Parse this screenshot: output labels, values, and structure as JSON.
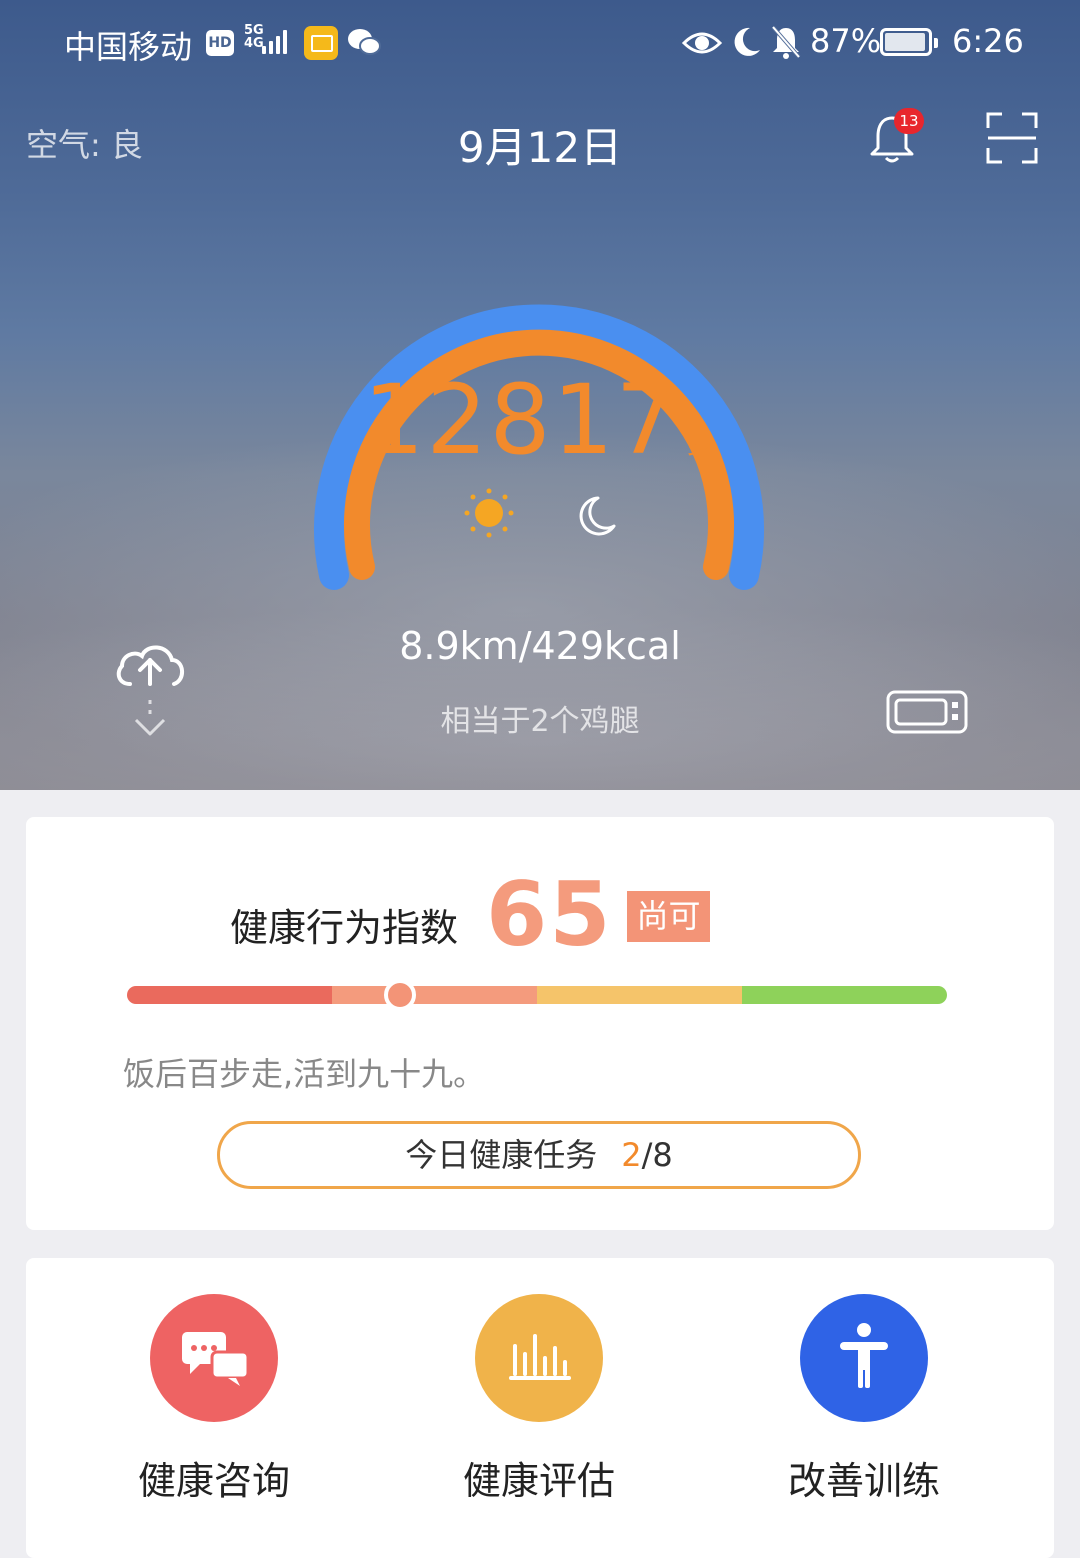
{
  "status_bar": {
    "carrier": "中国移动",
    "hd": "HD",
    "network_top": "5G",
    "network_bottom": "4G",
    "battery_percent": "87%",
    "time": "6:26"
  },
  "header": {
    "air_quality": "空气: 良",
    "date": "9月12日",
    "notification_count": "13"
  },
  "steps": {
    "count": "12817",
    "unit": "步",
    "distance_calories": "8.9km/429kcal",
    "equivalent": "相当于2个鸡腿",
    "gauge_fill_ratio": 0.98
  },
  "colors": {
    "gauge_blue": "#4a8ff0",
    "gauge_orange": "#f28a2c",
    "scale": [
      "#ea6a5d",
      "#f49b7d",
      "#f49b7d",
      "#f5c46a",
      "#8ed25a"
    ]
  },
  "health_index": {
    "label": "健康行为指数",
    "score": "65",
    "level": "尚可",
    "marker_fraction": 0.33,
    "motto": "饭后百步走,活到九十九。",
    "task_label": "今日健康任务",
    "task_done": "2",
    "task_total": "/8"
  },
  "functions": [
    {
      "label": "健康咨询",
      "icon": "chat-bubbles-icon",
      "color": "#ee6363"
    },
    {
      "label": "健康评估",
      "icon": "bar-chart-icon",
      "color": "#f0b34a"
    },
    {
      "label": "改善训练",
      "icon": "person-icon",
      "color": "#2f63e6"
    }
  ]
}
